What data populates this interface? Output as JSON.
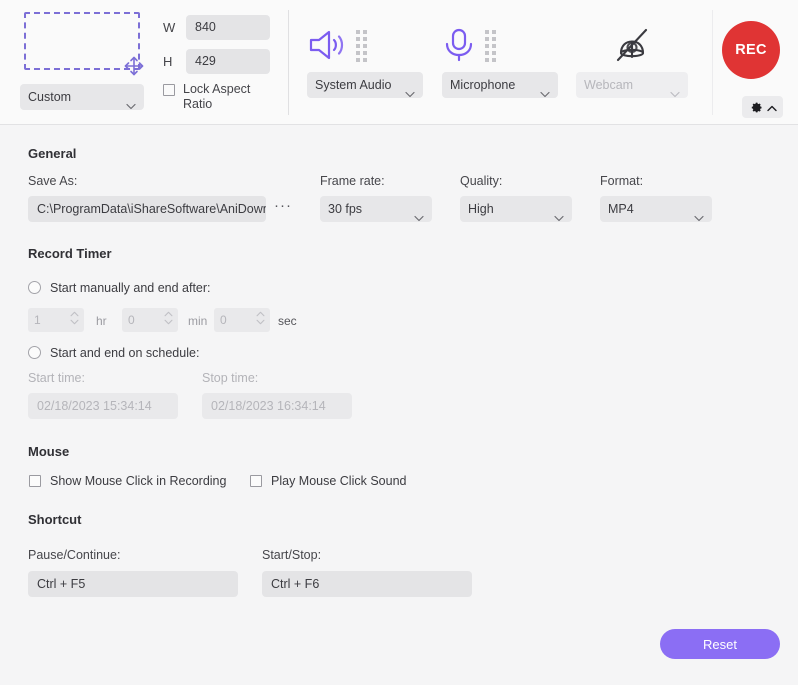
{
  "header": {
    "capture": {
      "preset_label": "Custom",
      "width_label": "W",
      "width_value": "840",
      "height_label": "H",
      "height_value": "429",
      "lock_aspect_label": "Lock Aspect Ratio"
    },
    "devices": [
      {
        "icon": "speaker-icon",
        "label": "System Audio",
        "enabled": true
      },
      {
        "icon": "microphone-icon",
        "label": "Microphone",
        "enabled": true
      },
      {
        "icon": "webcam-off-icon",
        "label": "Webcam",
        "enabled": false
      }
    ],
    "rec_label": "REC",
    "settings_icon": "gear-icon",
    "settings_chevron": "chevron-up-icon"
  },
  "general": {
    "title": "General",
    "save_as_label": "Save As:",
    "save_as_value": "C:\\ProgramData\\iShareSoftware\\AniDown",
    "browse_label": "···",
    "frame_rate_label": "Frame rate:",
    "frame_rate_value": "30 fps",
    "quality_label": "Quality:",
    "quality_value": "High",
    "format_label": "Format:",
    "format_value": "MP4"
  },
  "record_timer": {
    "title": "Record Timer",
    "manual_option_label": "Start manually and end after:",
    "hours_value": "1",
    "hours_unit": "hr",
    "minutes_value": "0",
    "minutes_unit": "min",
    "seconds_value": "0",
    "seconds_unit": "sec",
    "schedule_option_label": "Start and end on schedule:",
    "start_time_label": "Start time:",
    "start_time_value": "02/18/2023 15:34:14",
    "stop_time_label": "Stop time:",
    "stop_time_value": "02/18/2023 16:34:14"
  },
  "mouse": {
    "title": "Mouse",
    "show_click_label": "Show Mouse Click in Recording",
    "play_sound_label": "Play Mouse Click Sound"
  },
  "shortcut": {
    "title": "Shortcut",
    "pause_continue_label": "Pause/Continue:",
    "pause_continue_value": "Ctrl + F5",
    "start_stop_label": "Start/Stop:",
    "start_stop_value": "Ctrl + F6"
  },
  "footer": {
    "reset_label": "Reset"
  },
  "colors": {
    "accent_purple": "#8b6ef4",
    "rec_red": "#e03434",
    "header_bg": "#fafafa",
    "body_bg": "#f5f5f6"
  }
}
